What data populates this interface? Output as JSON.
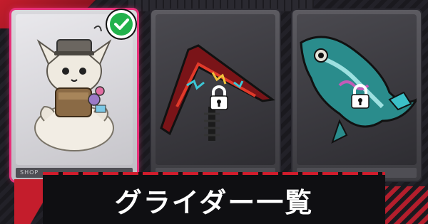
{
  "page_title": "グライダー一覧",
  "colors": {
    "accent_red": "#c41d2c",
    "selected_pink": "#e8317a",
    "check_green": "#22b24c"
  },
  "gliders": [
    {
      "state": "selected",
      "label_strip": "SHOP",
      "icon": "cat-creature-glider-art"
    },
    {
      "state": "locked",
      "label_strip": "",
      "icon": "red-delta-glider-art"
    },
    {
      "state": "locked",
      "label_strip": "",
      "icon": "koi-fish-glider-art"
    }
  ]
}
